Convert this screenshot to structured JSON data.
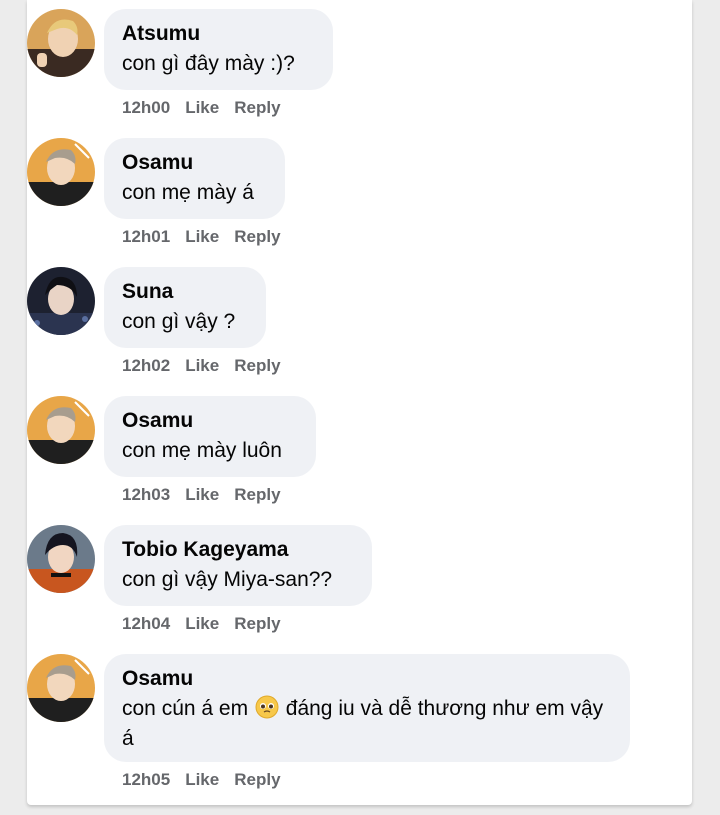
{
  "colors": {
    "bubble": "#eff1f5",
    "meta_text": "#65676b",
    "text": "#050505"
  },
  "actions": {
    "like": "Like",
    "reply": "Reply"
  },
  "comments": [
    {
      "author": "Atsumu",
      "text": "con gì đây mày :)?",
      "time": "12h00",
      "avatar": "atsumu-avatar"
    },
    {
      "author": "Osamu",
      "text": "con mẹ mày á",
      "time": "12h01",
      "avatar": "osamu-avatar"
    },
    {
      "author": "Suna",
      "text": "con gì vậy ?",
      "time": "12h02",
      "avatar": "suna-avatar"
    },
    {
      "author": "Osamu",
      "text": "con mẹ mày luôn",
      "time": "12h03",
      "avatar": "osamu-avatar"
    },
    {
      "author": "Tobio Kageyama",
      "text": "con gì vậy Miya-san??",
      "time": "12h04",
      "avatar": "kageyama-avatar"
    },
    {
      "author": "Osamu",
      "text_before_emoji": "con cún á em",
      "emoji": "pleading-face-emoji",
      "text_after_emoji": "đáng iu và dễ thương như em vậy á",
      "time": "12h05",
      "avatar": "osamu-avatar"
    }
  ]
}
